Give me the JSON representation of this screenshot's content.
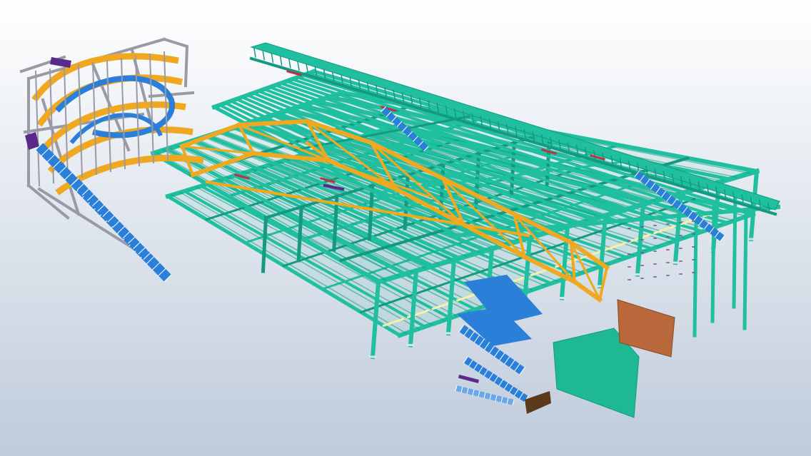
{
  "viewport": {
    "background_top": "#ffffff",
    "background_bottom": "#bfcbdb"
  },
  "model": {
    "description_icon": "steel-structure-3d-model",
    "colors": {
      "beam": "#1fbfa0",
      "beam_dark": "#139a80",
      "truss": "#f0a820",
      "stair": "#2a7fd8",
      "column_frame": "#9a9aa6",
      "bracing_accent": "#c03040",
      "purple_member": "#5a2a8a",
      "panel_brown": "#b8683a",
      "panel_green": "#1fb894",
      "dark_base": "#5a3a1a",
      "light_deck": "#f4f0a8"
    }
  }
}
